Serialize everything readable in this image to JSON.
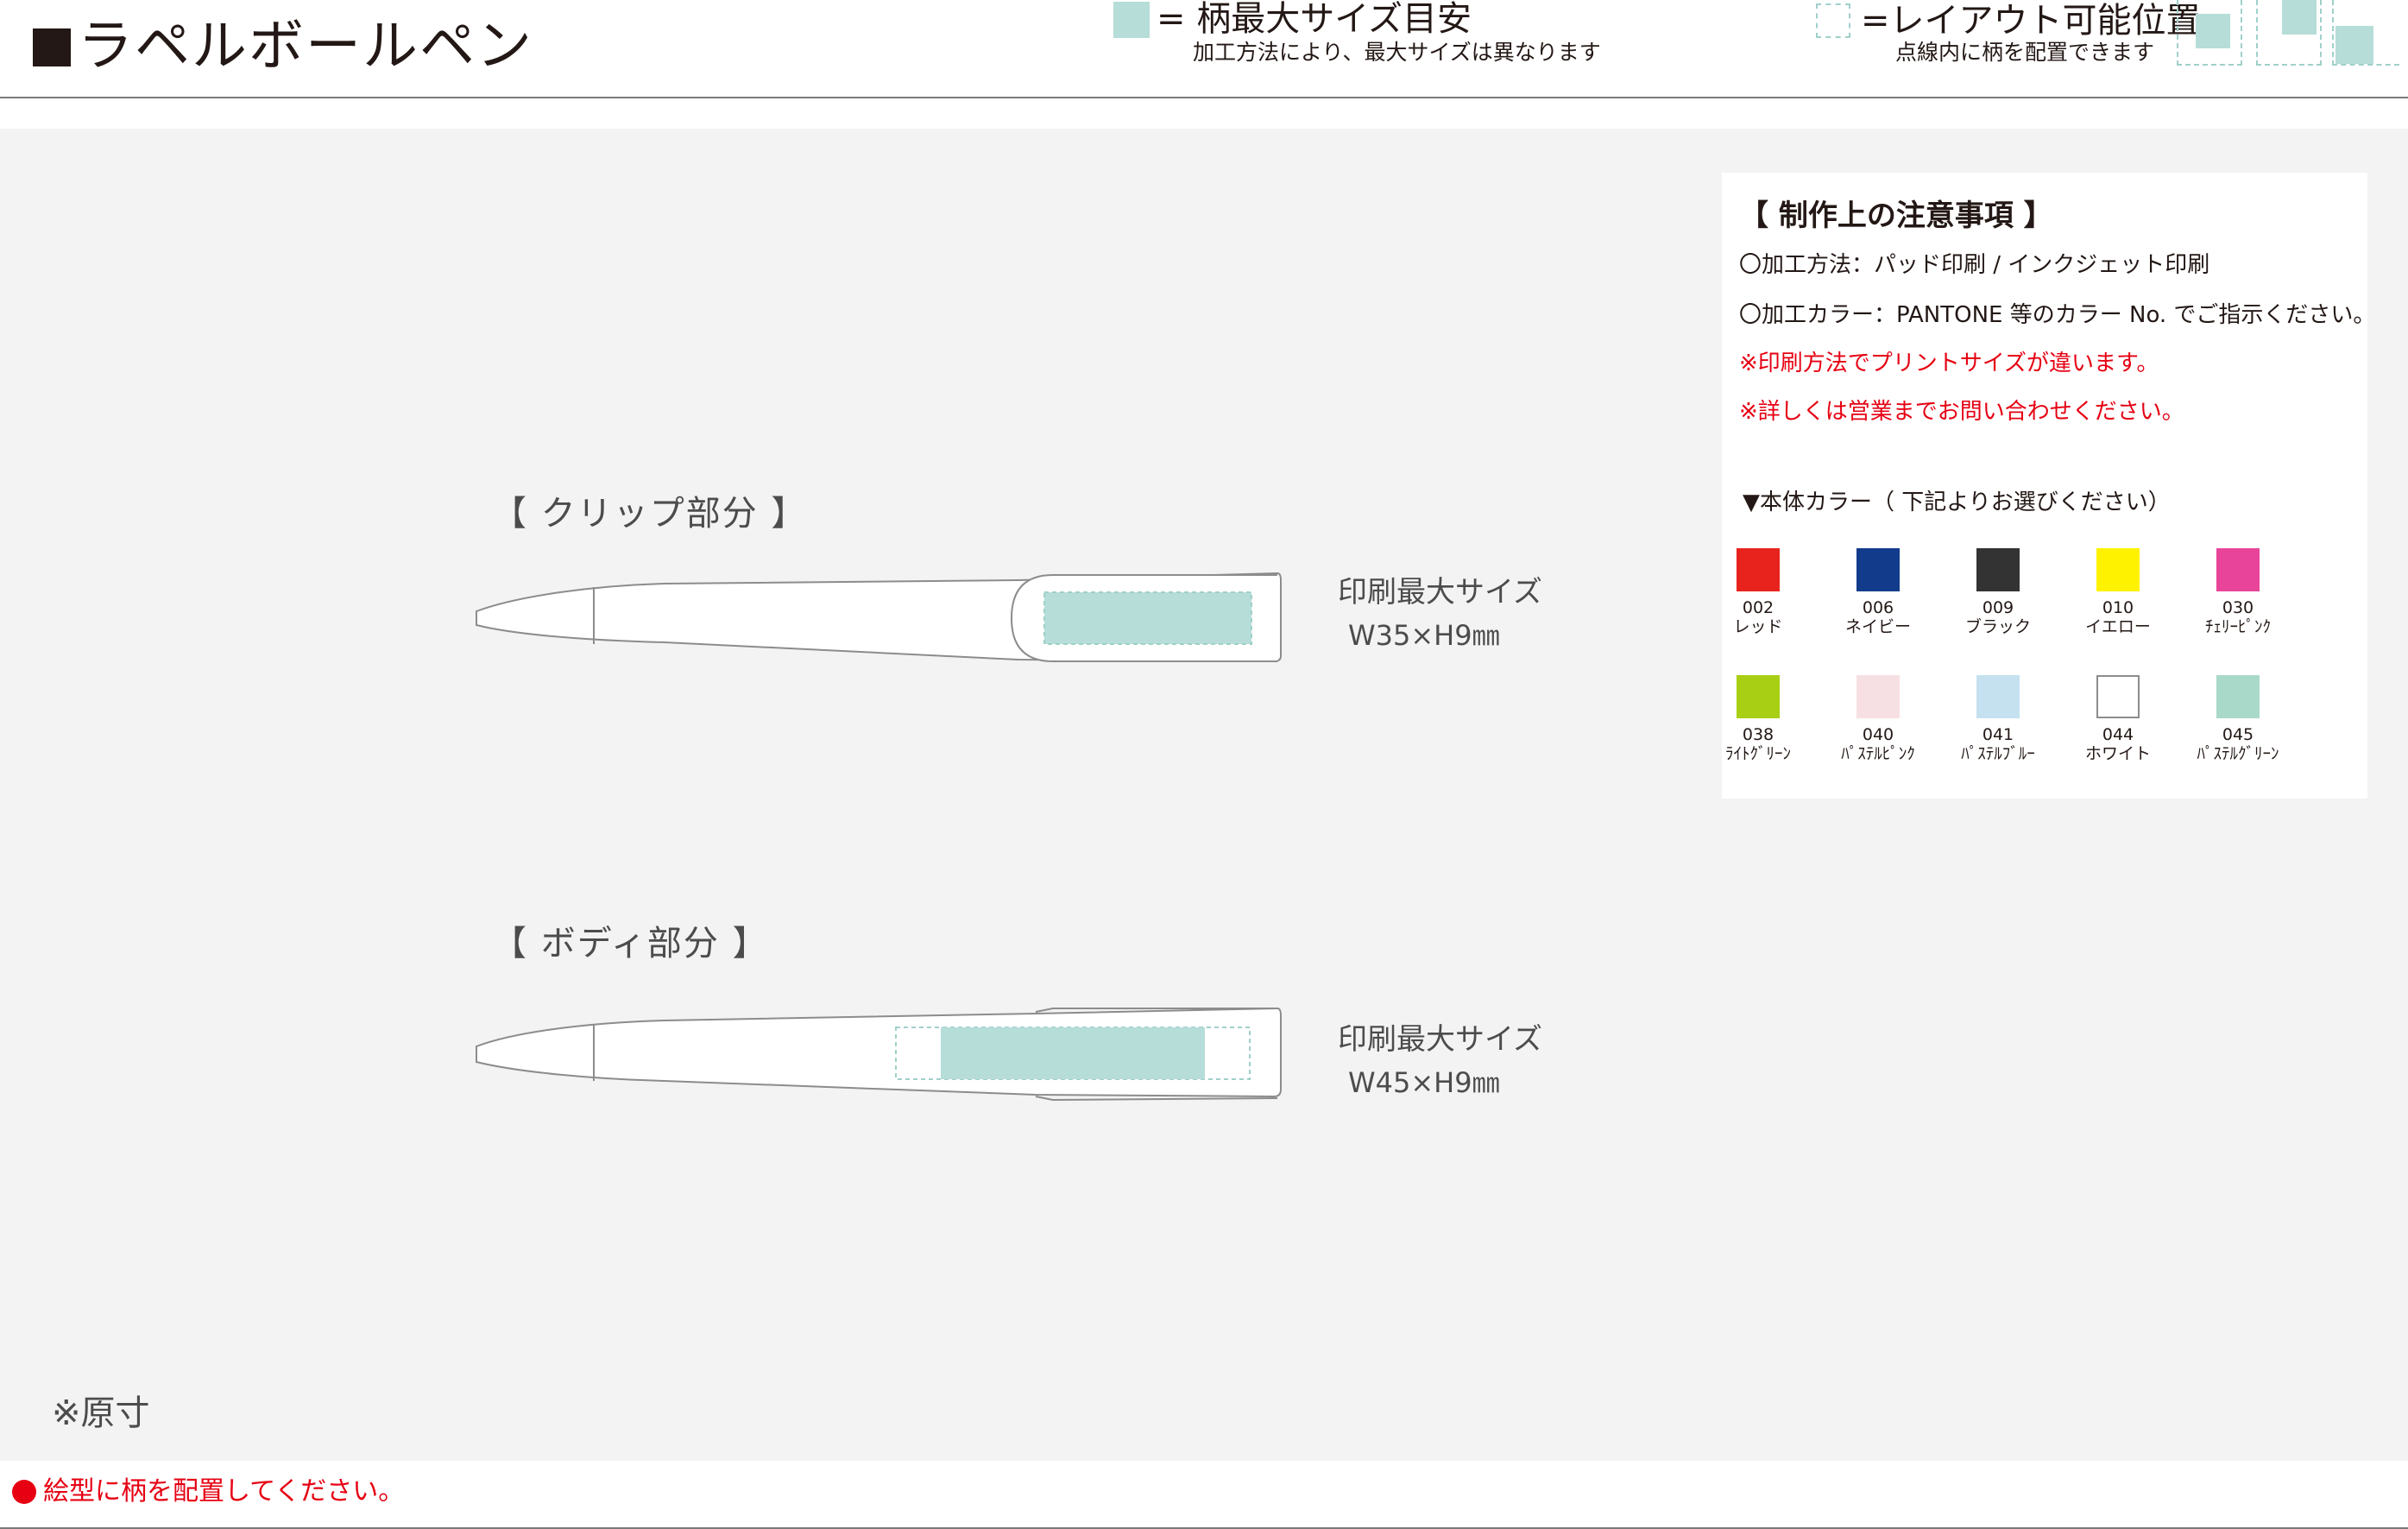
{
  "header": {
    "title": "ラペルボールペン",
    "legend_max_size_main": "= 柄最大サイズ目安",
    "legend_max_size_sub": "加工方法により、最大サイズは異なります",
    "legend_layout_main": "=レイアウト可能位置",
    "legend_layout_sub": "点線内に柄を配置できます"
  },
  "sections": [
    {
      "heading": "【  クリップ部分  】",
      "print_label": "印刷最大サイズ",
      "print_size": "W35×H9㎜"
    },
    {
      "heading": "【  ボディ部分  】",
      "print_label": "印刷最大サイズ",
      "print_size": "W45×H9㎜"
    }
  ],
  "notice": {
    "title": "【  制作上の注意事項  】",
    "lines": [
      "〇加工方法：パッド印刷 / インクジェット印刷",
      "〇加工カラー：PANTONE 等のカラー No. でご指示ください。"
    ],
    "warnings": [
      "※印刷方法でプリントサイズが違います。",
      "※詳しくは営業までお問い合わせください。"
    ],
    "colors_title": "▼本体カラー（ 下記よりお選びください）",
    "colors": [
      {
        "code": "002",
        "name": "レッド",
        "hex": "#e8231e"
      },
      {
        "code": "006",
        "name": "ネイビー",
        "hex": "#123b8c"
      },
      {
        "code": "009",
        "name": "ブラック",
        "hex": "#333333"
      },
      {
        "code": "010",
        "name": "イエロー",
        "hex": "#fff200"
      },
      {
        "code": "030",
        "name": "ﾁｪﾘｰﾋﾟﾝｸ",
        "hex": "#e8459a"
      },
      {
        "code": "038",
        "name": "ﾗｲﾄｸﾞﾘｰﾝ",
        "hex": "#a8cf14"
      },
      {
        "code": "040",
        "name": "ﾊﾟｽﾃﾙﾋﾟﾝｸ",
        "hex": "#f7e0e3"
      },
      {
        "code": "041",
        "name": "ﾊﾟｽﾃﾙﾌﾞﾙｰ",
        "hex": "#c5e1f0"
      },
      {
        "code": "044",
        "name": "ホワイト",
        "hex": "#ffffff"
      },
      {
        "code": "045",
        "name": "ﾊﾟｽﾃﾙｸﾞﾘｰﾝ",
        "hex": "#a9d9c8"
      }
    ]
  },
  "original_size_note": "※原寸",
  "footer_note": "絵型に柄を配置してください。",
  "palette": {
    "print_area": "#b6ddd8",
    "layout_dash": "#9fd0ca",
    "warning_red": "#e60012"
  }
}
